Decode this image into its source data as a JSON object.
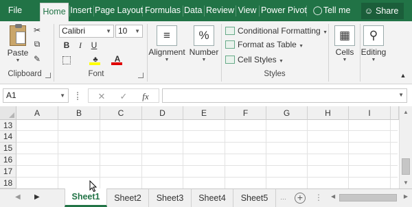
{
  "tabs": [
    "File",
    "Home",
    "Insert",
    "Page Layout",
    "Formulas",
    "Data",
    "Review",
    "View",
    "Power Pivot"
  ],
  "active_tab": "Home",
  "tell_me": "Tell me",
  "share": "Share",
  "clipboard": {
    "paste": "Paste",
    "label": "Clipboard"
  },
  "font": {
    "name": "Calibri",
    "size": "10",
    "label": "Font",
    "bold": "B",
    "italic": "I",
    "underline": "U",
    "font_color_glyph": "A"
  },
  "alignment": {
    "label": "Alignment"
  },
  "number": {
    "label": "Number",
    "glyph": "%"
  },
  "styles": {
    "conditional_formatting": "Conditional Formatting",
    "format_as_table": "Format as Table",
    "cell_styles": "Cell Styles",
    "label": "Styles"
  },
  "cells": {
    "label": "Cells"
  },
  "editing": {
    "label": "Editing"
  },
  "formula_bar": {
    "name_box": "A1",
    "cancel": "✕",
    "enter": "✓",
    "fx": "fx",
    "value": ""
  },
  "columns": [
    "A",
    "B",
    "C",
    "D",
    "E",
    "F",
    "G",
    "H",
    "I"
  ],
  "rows": [
    "13",
    "14",
    "15",
    "16",
    "17",
    "18"
  ],
  "sheets": [
    "Sheet1",
    "Sheet2",
    "Sheet3",
    "Sheet4",
    "Sheet5"
  ],
  "active_sheet": "Sheet1",
  "colors": {
    "accent": "#217346",
    "ribbon": "#f3f3f3",
    "highlight_yellow": "#ffff00",
    "font_red": "#e00000"
  }
}
